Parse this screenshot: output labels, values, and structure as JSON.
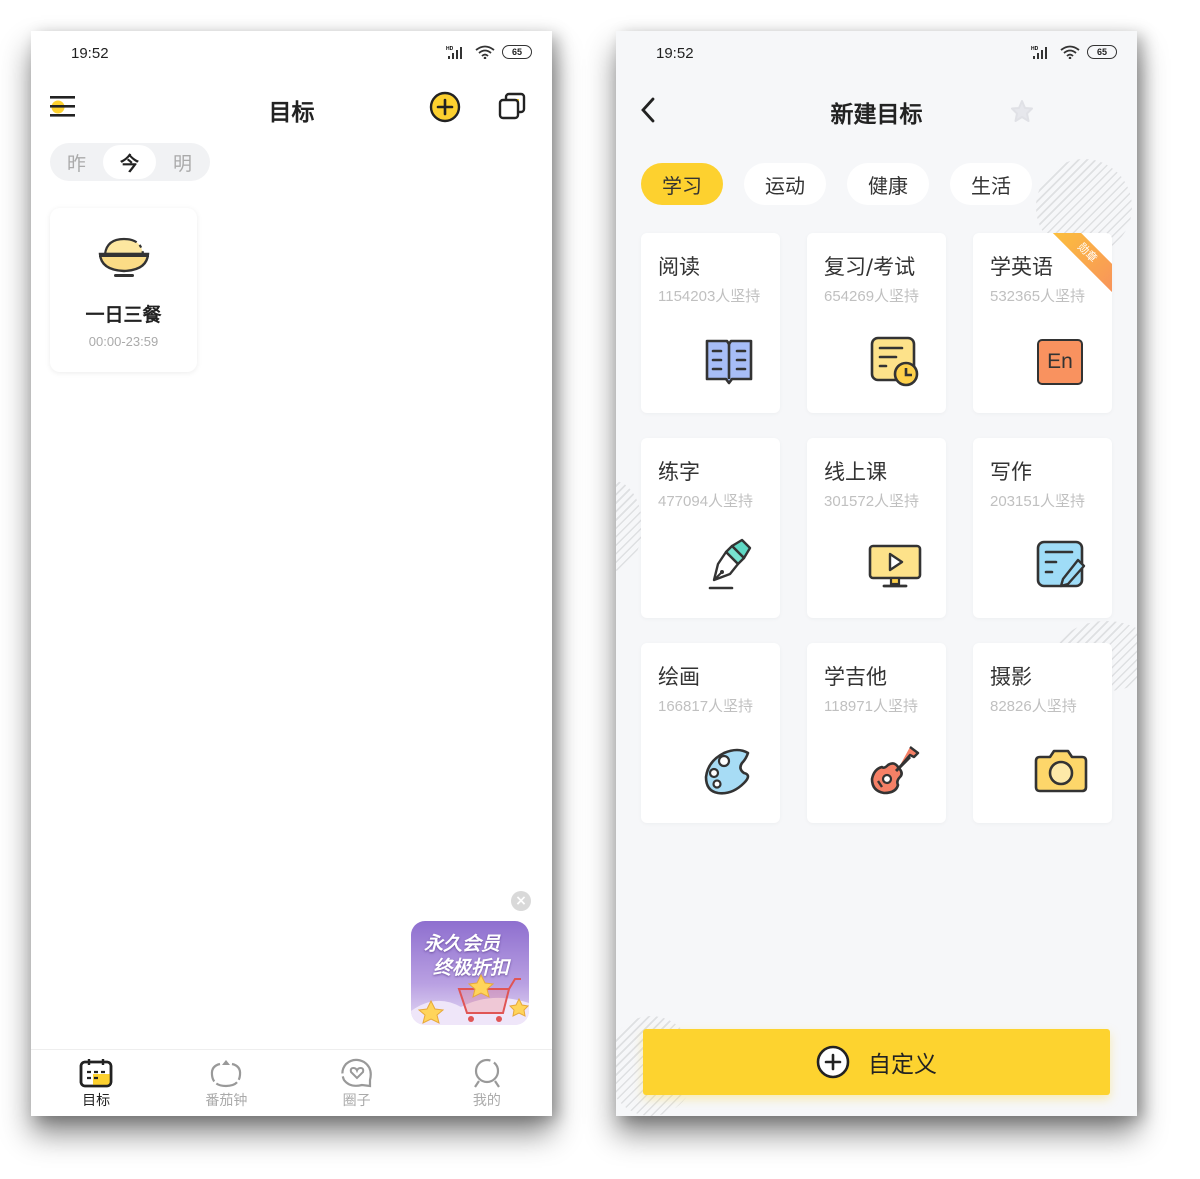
{
  "status_bar": {
    "time": "19:52",
    "network": "HD",
    "battery": "65"
  },
  "left_screen": {
    "header": {
      "title": "目标"
    },
    "day_switch": [
      {
        "label": "昨",
        "active": false
      },
      {
        "label": "今",
        "active": true
      },
      {
        "label": "明",
        "active": false
      }
    ],
    "goals": [
      {
        "name": "一日三餐",
        "time": "00:00-23:59",
        "icon": "rice-bowl-icon"
      }
    ],
    "promo": {
      "line1": "永久会员",
      "line2": "终极折扣"
    },
    "tabbar": [
      {
        "label": "目标",
        "icon": "calendar-icon",
        "active": true
      },
      {
        "label": "番茄钟",
        "icon": "tomato-icon",
        "active": false
      },
      {
        "label": "圈子",
        "icon": "heart-chat-icon",
        "active": false
      },
      {
        "label": "我的",
        "icon": "profile-icon",
        "active": false
      }
    ]
  },
  "right_screen": {
    "header": {
      "title": "新建目标"
    },
    "categories": [
      {
        "label": "学习",
        "active": true
      },
      {
        "label": "运动",
        "active": false
      },
      {
        "label": "健康",
        "active": false
      },
      {
        "label": "生活",
        "active": false
      }
    ],
    "templates": [
      {
        "name": "阅读",
        "count": "1154203人坚持",
        "icon": "book-icon"
      },
      {
        "name": "复习/考试",
        "count": "654269人坚持",
        "icon": "schedule-clock-icon"
      },
      {
        "name": "学英语",
        "count": "532365人坚持",
        "icon": "english-icon",
        "badge": "勋章",
        "icon_text": "En"
      },
      {
        "name": "练字",
        "count": "477094人坚持",
        "icon": "pen-icon"
      },
      {
        "name": "线上课",
        "count": "301572人坚持",
        "icon": "monitor-play-icon"
      },
      {
        "name": "写作",
        "count": "203151人坚持",
        "icon": "note-edit-icon"
      },
      {
        "name": "绘画",
        "count": "166817人坚持",
        "icon": "palette-icon"
      },
      {
        "name": "学吉他",
        "count": "118971人坚持",
        "icon": "guitar-icon"
      },
      {
        "name": "摄影",
        "count": "82826人坚持",
        "icon": "camera-icon"
      }
    ],
    "custom_button": {
      "label": "自定义"
    }
  },
  "colors": {
    "accent": "#fdd32f",
    "text": "#222222",
    "muted": "#c0c0c0",
    "bg_right": "#f6f7f9"
  }
}
